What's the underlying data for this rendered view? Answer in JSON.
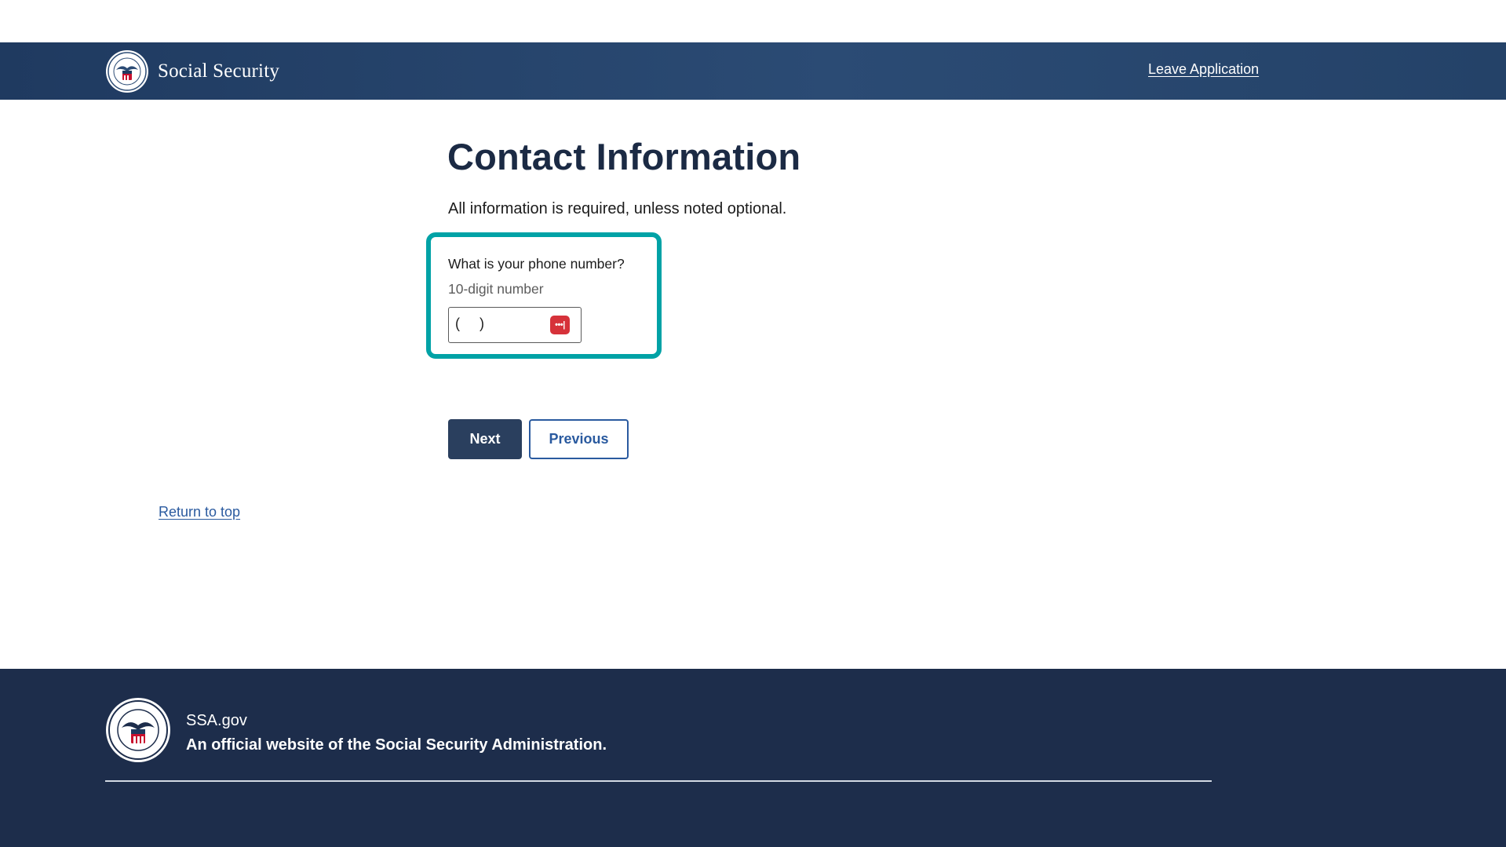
{
  "header": {
    "brand_name": "Social Security",
    "leave_link": "Leave Application"
  },
  "main": {
    "title": "Contact Information",
    "intro": "All information is required, unless noted optional.",
    "phone_field": {
      "label": "What is your phone number?",
      "hint": "10-digit number",
      "mask": "(     )",
      "icon_glyph": "•••|"
    },
    "buttons": {
      "next": "Next",
      "previous": "Previous"
    },
    "return_to_top": "Return to top"
  },
  "footer": {
    "domain": "SSA.gov",
    "official": "An official website of the Social Security Administration."
  },
  "colors": {
    "header_bg": "#2b4b74",
    "footer_bg": "#1d2d4b",
    "focus_outline": "#00a2a6",
    "primary_button": "#2a3f5e",
    "link": "#2a5a9f",
    "icon_red": "#d6323a"
  }
}
